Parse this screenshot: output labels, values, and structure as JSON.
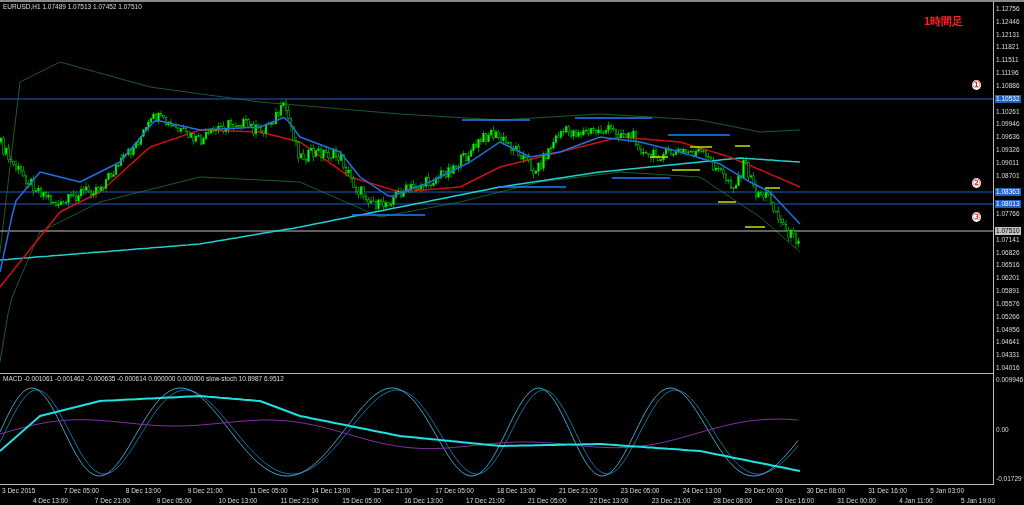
{
  "chart_header": {
    "symbol": "EURUSD,H1",
    "quotes": "1.07489 1.07513 1.07452 1.07510"
  },
  "timeframe_label": "1時間足",
  "markers": [
    "①",
    "②",
    "③"
  ],
  "price_axis": {
    "labels": [
      "1.12756",
      "1.12446",
      "1.12131",
      "1.11821",
      "1.11511",
      "1.11196",
      "1.10886",
      "1.10261",
      "1.09946",
      "1.09636",
      "1.09326",
      "1.09011",
      "1.08701",
      "1.07766",
      "1.07141",
      "1.06826",
      "1.06516",
      "1.06201",
      "1.05891",
      "1.05576",
      "1.05266",
      "1.04956",
      "1.04641",
      "1.04331",
      "1.04016"
    ]
  },
  "horizontal_lines": [
    {
      "tag": "1.10532",
      "color": "#1f5fbf"
    },
    {
      "tag": "1.08363",
      "color": "#1f5fbf"
    },
    {
      "tag": "1.08013",
      "color": "#1f5fbf"
    },
    {
      "tag": "1.07510",
      "color": "#c0c0c0"
    }
  ],
  "indicator": {
    "header": "MACD -0.001061 -0.001462 -0.000635 -0.000614 0.000000 0.000000 slow-stoch 10.8987 6.9512",
    "axis_labels": [
      "0.009946",
      "0.00",
      "-0.01729"
    ]
  },
  "time_axis": [
    "3 Dec 2015",
    "4 Dec 13:00",
    "7 Dec 05:00",
    "7 Dec 21:00",
    "8 Dec 13:00",
    "9 Dec 05:00",
    "9 Dec 21:00",
    "10 Dec 13:00",
    "11 Dec 05:00",
    "11 Dec 21:00",
    "14 Dec 13:00",
    "15 Dec 05:00",
    "15 Dec 21:00",
    "16 Dec 13:00",
    "17 Dec 05:00",
    "17 Dec 21:00",
    "18 Dec 13:00",
    "21 Dec 05:00",
    "21 Dec 21:00",
    "22 Dec 13:00",
    "23 Dec 05:00",
    "23 Dec 21:00",
    "24 Dec 13:00",
    "28 Dec 08:00",
    "29 Dec 00:00",
    "29 Dec 16:00",
    "30 Dec 08:00",
    "31 Dec 00:00",
    "31 Dec 16:00",
    "4 Jan 11:00",
    "5 Jan 03:00",
    "5 Jan 19:00"
  ]
}
